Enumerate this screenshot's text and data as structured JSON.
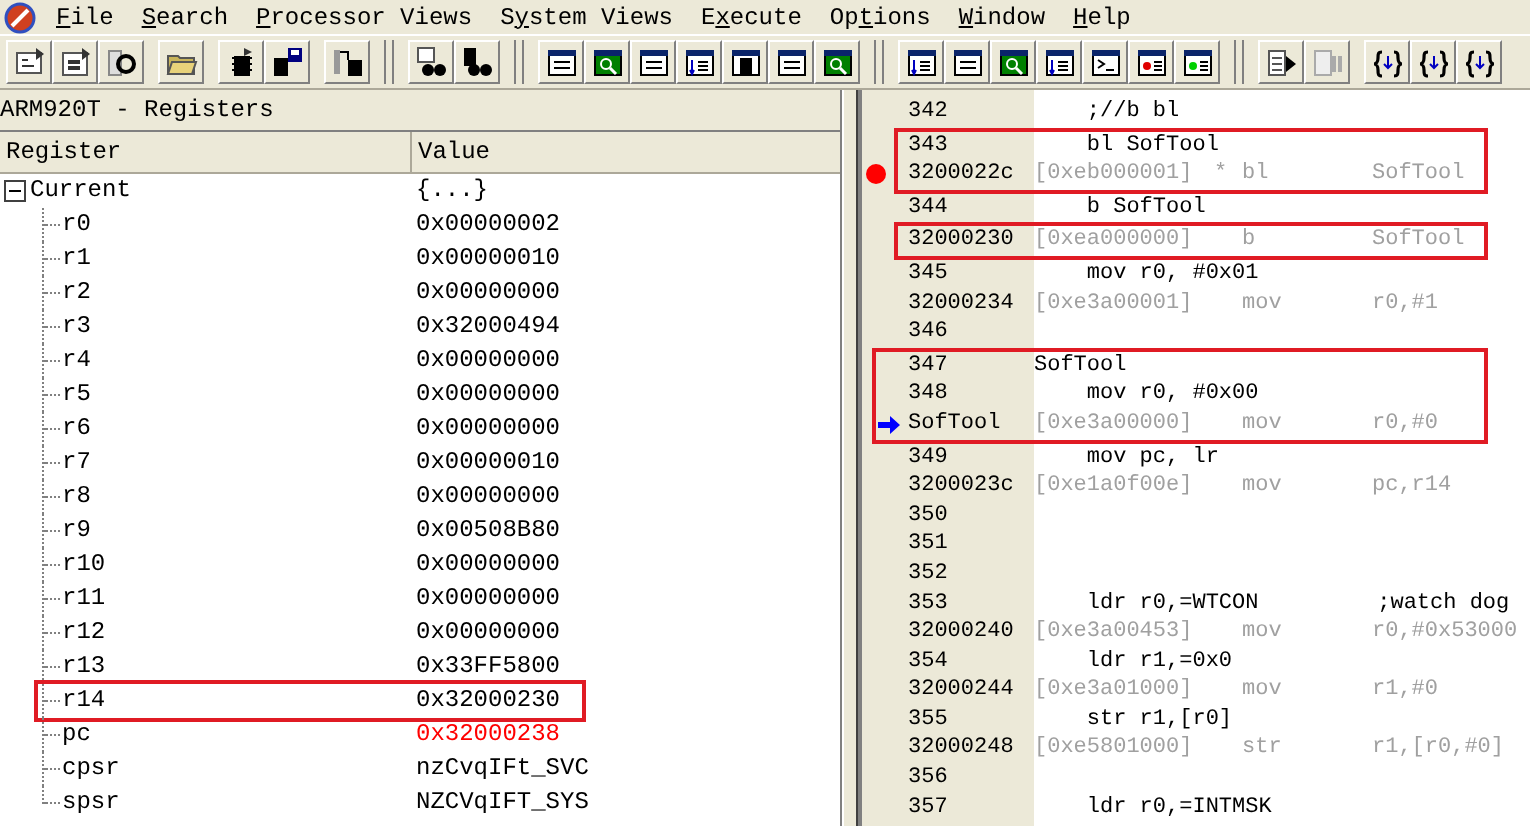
{
  "menu": [
    {
      "key": "F",
      "post": "ile"
    },
    {
      "key": "S",
      "post": "earch"
    },
    {
      "key": "P",
      "post": "rocessor Views"
    },
    {
      "pre": "S",
      "key": "y",
      "post": "stem Views"
    },
    {
      "pre": "E",
      "key": "x",
      "post": "ecute"
    },
    {
      "pre": "Op",
      "key": "t",
      "post": "ions"
    },
    {
      "key": "W",
      "post": "indow"
    },
    {
      "key": "H",
      "post": "elp"
    }
  ],
  "registers": {
    "title": "ARM920T - Registers",
    "columns": [
      "Register",
      "Value"
    ],
    "root": {
      "name": "Current",
      "value": "{...}",
      "expanded": true,
      "children": [
        {
          "name": "r0",
          "value": "0x00000002",
          "changed": false,
          "highlighted": false
        },
        {
          "name": "r1",
          "value": "0x00000010",
          "changed": false,
          "highlighted": false
        },
        {
          "name": "r2",
          "value": "0x00000000",
          "changed": false,
          "highlighted": false
        },
        {
          "name": "r3",
          "value": "0x32000494",
          "changed": false,
          "highlighted": false
        },
        {
          "name": "r4",
          "value": "0x00000000",
          "changed": false,
          "highlighted": false
        },
        {
          "name": "r5",
          "value": "0x00000000",
          "changed": false,
          "highlighted": false
        },
        {
          "name": "r6",
          "value": "0x00000000",
          "changed": false,
          "highlighted": false
        },
        {
          "name": "r7",
          "value": "0x00000010",
          "changed": false,
          "highlighted": false
        },
        {
          "name": "r8",
          "value": "0x00000000",
          "changed": false,
          "highlighted": false
        },
        {
          "name": "r9",
          "value": "0x00508B80",
          "changed": false,
          "highlighted": false
        },
        {
          "name": "r10",
          "value": "0x00000000",
          "changed": false,
          "highlighted": false
        },
        {
          "name": "r11",
          "value": "0x00000000",
          "changed": false,
          "highlighted": false
        },
        {
          "name": "r12",
          "value": "0x00000000",
          "changed": false,
          "highlighted": false
        },
        {
          "name": "r13",
          "value": "0x33FF5800",
          "changed": false,
          "highlighted": false
        },
        {
          "name": "r14",
          "value": "0x32000230",
          "changed": false,
          "highlighted": true
        },
        {
          "name": "pc",
          "value": "0x32000238",
          "changed": true,
          "highlighted": false
        },
        {
          "name": "cpsr",
          "value": "nzCvqIFt_SVC",
          "changed": false,
          "highlighted": false
        },
        {
          "name": "spsr",
          "value": "NZCVqIFT_SYS",
          "changed": false,
          "highlighted": false
        }
      ]
    }
  },
  "code": {
    "blocks": [
      {
        "boxed": false,
        "lines": [
          {
            "kind": "source",
            "number": "342",
            "text": "    ;//b bl"
          }
        ]
      },
      {
        "boxed": true,
        "lines": [
          {
            "kind": "source",
            "number": "343",
            "text": "    bl SofTool"
          },
          {
            "kind": "disasm",
            "address": "3200022c",
            "opcode": "[0xeb000001]",
            "flag": "*",
            "mnemonic": "bl",
            "operands": "SofTool",
            "breakpoint": true,
            "current": false
          }
        ]
      },
      {
        "boxed": false,
        "lines": [
          {
            "kind": "source",
            "number": "344",
            "text": "    b SofTool"
          }
        ]
      },
      {
        "boxed": true,
        "lines": [
          {
            "kind": "disasm",
            "address": "32000230",
            "opcode": "[0xea000000]",
            "mnemonic": "b",
            "operands": "SofTool",
            "breakpoint": false,
            "current": false
          }
        ]
      },
      {
        "boxed": false,
        "lines": [
          {
            "kind": "source",
            "number": "345",
            "text": "    mov r0, #0x01"
          },
          {
            "kind": "disasm",
            "address": "32000234",
            "opcode": "[0xe3a00001]",
            "mnemonic": "mov",
            "operands": "r0,#1",
            "breakpoint": false,
            "current": false
          },
          {
            "kind": "source",
            "number": "346"
          }
        ]
      },
      {
        "boxed": true,
        "lines": [
          {
            "kind": "source",
            "number": "347",
            "text": "SofTool"
          },
          {
            "kind": "source",
            "number": "348",
            "text": "    mov r0, #0x00"
          },
          {
            "kind": "disasm",
            "address": "SofTool",
            "opcode": "[0xe3a00000]",
            "mnemonic": "mov",
            "operands": "r0,#0",
            "breakpoint": false,
            "current": true
          }
        ]
      },
      {
        "boxed": false,
        "lines": [
          {
            "kind": "source",
            "number": "349",
            "text": "    mov pc, lr"
          },
          {
            "kind": "disasm",
            "address": "3200023c",
            "opcode": "[0xe1a0f00e]",
            "mnemonic": "mov",
            "operands": "pc,r14",
            "breakpoint": false,
            "current": false
          },
          {
            "kind": "source",
            "number": "350"
          },
          {
            "kind": "source",
            "number": "351"
          },
          {
            "kind": "source",
            "number": "352"
          },
          {
            "kind": "source",
            "number": "353",
            "text": "    ldr r0,=WTCON         ;watch dog"
          },
          {
            "kind": "disasm",
            "address": "32000240",
            "opcode": "[0xe3a00453]",
            "mnemonic": "mov",
            "operands": "r0,#0x53000",
            "breakpoint": false,
            "current": false
          },
          {
            "kind": "source",
            "number": "354",
            "text": "    ldr r1,=0x0"
          },
          {
            "kind": "disasm",
            "address": "32000244",
            "opcode": "[0xe3a01000]",
            "mnemonic": "mov",
            "operands": "r1,#0",
            "breakpoint": false,
            "current": false
          },
          {
            "kind": "source",
            "number": "355",
            "text": "    str r1,[r0]"
          },
          {
            "kind": "disasm",
            "address": "32000248",
            "opcode": "[0xe5801000]",
            "mnemonic": "str",
            "operands": "r1,[r0,#0]",
            "breakpoint": false,
            "current": false
          },
          {
            "kind": "source",
            "number": "356"
          },
          {
            "kind": "source",
            "number": "357",
            "text": "    ldr r0,=INTMSK"
          }
        ]
      }
    ]
  }
}
